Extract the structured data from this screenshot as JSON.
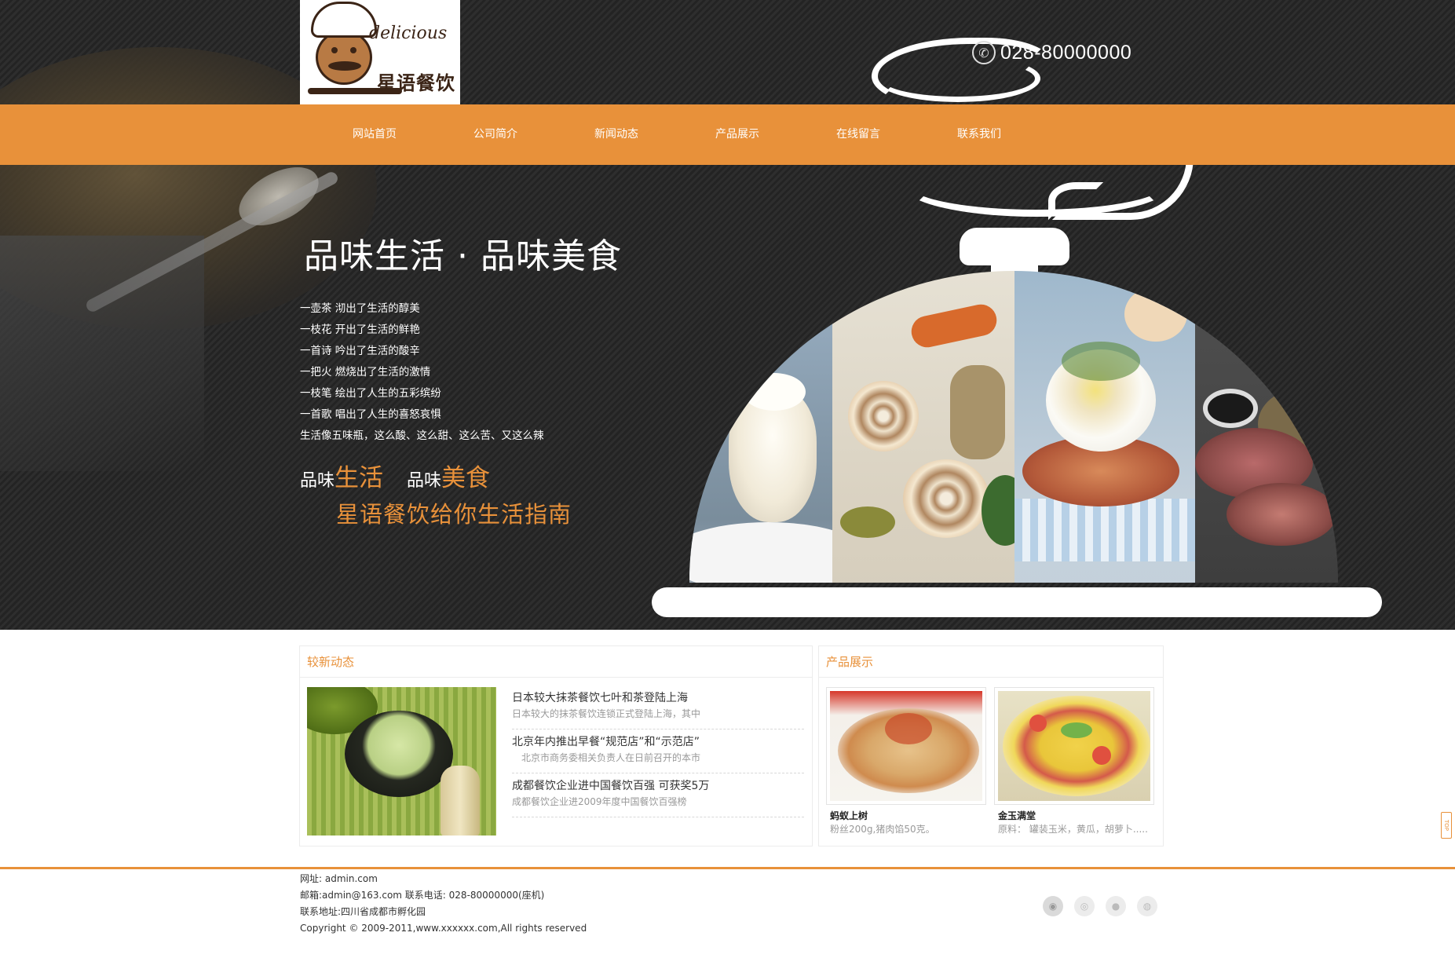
{
  "header": {
    "logo_en": "delicious",
    "logo_cn": "星语餐饮",
    "phone": "028-80000000",
    "phone_icon": "phone-icon"
  },
  "nav": {
    "items": [
      "网站首页",
      "公司简介",
      "新闻动态",
      "产品展示",
      "在线留言",
      "联系我们"
    ]
  },
  "hero": {
    "title": "品味生活 · 品味美食",
    "poem": [
      "一壶茶  沏出了生活的醇美",
      "一枝花  开出了生活的鲜艳",
      "一首诗  吟出了生活的酸辛",
      "一把火  燃烧出了生活的激情",
      "一枝笔  绘出了人生的五彩缤纷",
      "一首歌  唱出了人生的喜怒哀惧",
      "生活像五味瓶，这么酸、这么甜、这么苦、又这么辣"
    ],
    "slogan_prefix_1": "品味",
    "slogan_big_1": "生活",
    "slogan_prefix_2": "品味",
    "slogan_big_2": "美食",
    "slogan_2": "星语餐饮给你生活指南"
  },
  "news": {
    "heading": "较新动态",
    "items": [
      {
        "title": "日本较大抹茶餐饮七叶和茶登陆上海",
        "desc": "日本较大的抹茶餐饮连锁正式登陆上海，其中"
      },
      {
        "title": "北京年内推出早餐“规范店”和“示范店”",
        "desc": "北京市商务委相关负责人在日前召开的本市"
      },
      {
        "title": "成都餐饮企业进中国餐饮百强 可获奖5万",
        "desc": "成都餐饮企业进2009年度中国餐饮百强榜"
      }
    ]
  },
  "products": {
    "heading": "产品展示",
    "items": [
      {
        "name": "蚂蚁上树",
        "desc": "粉丝200g,猪肉馅50克。"
      },
      {
        "name": "金玉满堂",
        "desc": "原料：  罐装玉米，黄瓜，胡萝卜....."
      }
    ]
  },
  "footer": {
    "site": "网址: admin.com",
    "contact": "邮箱:admin@163.com   联系电话: 028-80000000(座机)",
    "address": "联系地址:四川省成都市孵化园",
    "copyright": "Copyright © 2009-2011,www.xxxxxx.com,All rights reserved",
    "social_icons": [
      "location-icon",
      "weibo-icon",
      "wechat-icon",
      "qq-icon"
    ]
  },
  "top_button": "TOP",
  "colors": {
    "accent": "#e8913a",
    "hero_bg": "#2a2a2a",
    "text": "#333333",
    "muted": "#999999"
  }
}
